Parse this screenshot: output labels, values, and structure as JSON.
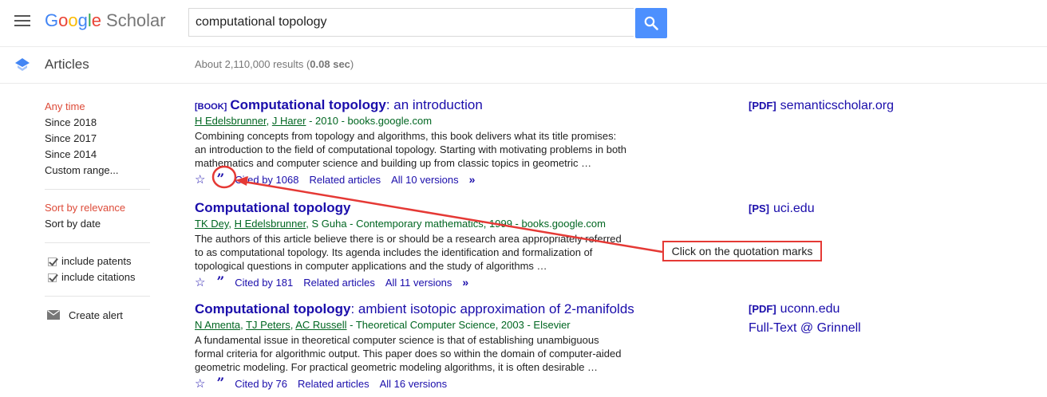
{
  "header": {
    "logo_letters": [
      "G",
      "o",
      "o",
      "g",
      "l",
      "e"
    ],
    "logo_product": "Scholar",
    "search_value": "computational topology",
    "search_placeholder": ""
  },
  "subheader": {
    "section_title": "Articles",
    "result_stats": "About 2,110,000 results (",
    "result_time": "0.08 sec",
    "result_stats_end": ")"
  },
  "sidebar": {
    "time_filters": [
      "Any time",
      "Since 2018",
      "Since 2017",
      "Since 2014",
      "Custom range..."
    ],
    "sort_options": [
      "Sort by relevance",
      "Sort by date"
    ],
    "checkboxes": [
      "include patents",
      "include citations"
    ],
    "create_alert": "Create alert"
  },
  "results": [
    {
      "tag": "[BOOK]",
      "title_bold": "Computational topology",
      "title_rest": ": an introduction",
      "authors": [
        "H Edelsbrunner",
        "J Harer"
      ],
      "source": " - 2010 - books.google.com",
      "snippet": "Combining concepts from topology and algorithms, this book delivers what its title promises: an introduction to the field of computational topology. Starting with motivating problems in both mathematics and computer science and building up from classic topics in geometric …",
      "cited_by": "Cited by 1068",
      "related": "Related articles",
      "versions": "All 10 versions",
      "has_more": true,
      "side_type": "[PDF]",
      "side_link": "semanticscholar.org",
      "side_link2": ""
    },
    {
      "tag": "",
      "title_bold": "Computational topology",
      "title_rest": "",
      "authors": [
        "TK Dey",
        "H Edelsbrunner"
      ],
      "source": ", S Guha - Contemporary mathematics, 1999 - books.google.com",
      "snippet": "The authors of this article believe there is or should be a research area appropriately referred to as computational topology. Its agenda includes the identification and formalization of topological questions in computer applications and the study of algorithms …",
      "cited_by": "Cited by 181",
      "related": "Related articles",
      "versions": "All 11 versions",
      "has_more": true,
      "side_type": "[PS]",
      "side_link": "uci.edu",
      "side_link2": ""
    },
    {
      "tag": "",
      "title_bold": "Computational topology",
      "title_rest": ": ambient isotopic approximation of 2-manifolds",
      "authors": [
        "N Amenta",
        "TJ Peters",
        "AC Russell"
      ],
      "source": " - Theoretical Computer Science, 2003 - Elsevier",
      "snippet": "A fundamental issue in theoretical computer science is that of establishing unambiguous formal criteria for algorithmic output. This paper does so within the domain of computer-aided geometric modeling. For practical geometric modeling algorithms, it is often desirable …",
      "cited_by": "Cited by 76",
      "related": "Related articles",
      "versions": "All 16 versions",
      "has_more": false,
      "side_type": "[PDF]",
      "side_link": "uconn.edu",
      "side_link2": "Full-Text @ Grinnell"
    }
  ],
  "annotation": {
    "text": "Click on the quotation marks",
    "color": "#e53935"
  },
  "colors": {
    "link": "#1a0dab",
    "author_green": "#006621",
    "active_red": "#dd4b39",
    "search_blue": "#4d90fe"
  },
  "icons": {
    "menu": "hamburger-icon",
    "search": "search-icon",
    "articles": "scholar-cap-icon",
    "star": "star-icon",
    "cite": "quotation-marks-icon",
    "more": "double-chevron-icon",
    "mail": "envelope-icon"
  }
}
